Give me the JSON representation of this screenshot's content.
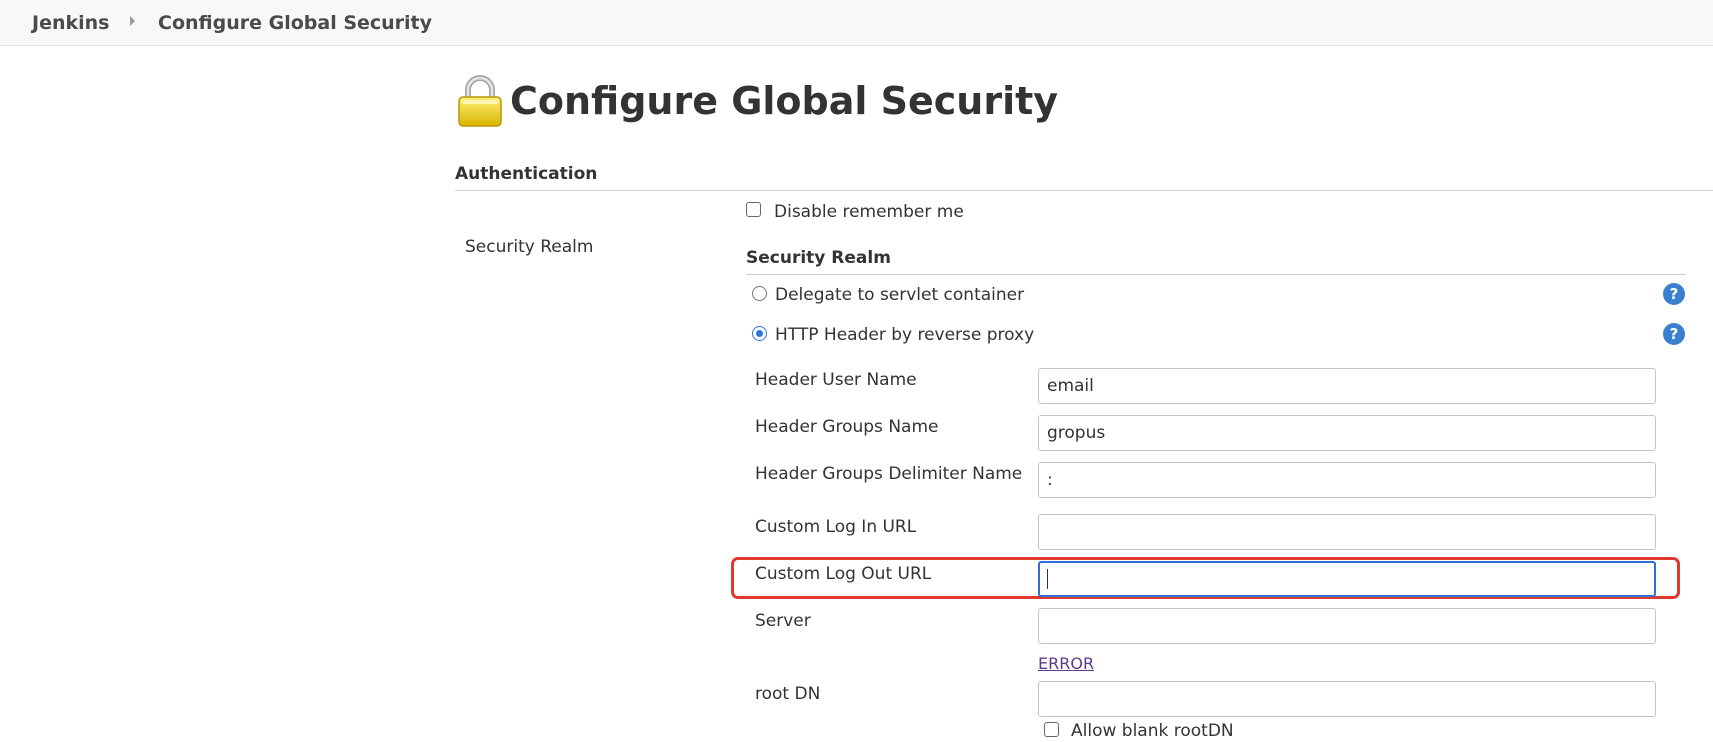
{
  "breadcrumb": {
    "home": "Jenkins",
    "current": "Configure Global Security"
  },
  "page": {
    "title": "Configure Global Security",
    "icon": "lock-icon"
  },
  "authentication": {
    "heading": "Authentication",
    "disable_remember_me": {
      "label": "Disable remember me",
      "checked": false
    }
  },
  "security_realm": {
    "left_label": "Security Realm",
    "heading": "Security Realm",
    "options": [
      {
        "label": "Delegate to servlet container",
        "selected": false
      },
      {
        "label": "HTTP Header by reverse proxy",
        "selected": true
      }
    ],
    "fields": {
      "header_user_name": {
        "label": "Header User Name",
        "value": "email"
      },
      "header_groups_name": {
        "label": "Header Groups Name",
        "value": "gropus"
      },
      "header_groups_delimiter": {
        "label": "Header Groups Delimiter Name",
        "value": ":"
      },
      "custom_login_url": {
        "label": "Custom Log In URL",
        "value": ""
      },
      "custom_logout_url": {
        "label": "Custom Log Out URL",
        "value": ""
      },
      "server": {
        "label": "Server",
        "value": ""
      },
      "root_dn": {
        "label": "root DN",
        "value": ""
      }
    },
    "server_error": "ERROR",
    "allow_blank_rootdn": {
      "label": "Allow blank rootDN",
      "checked": false
    }
  },
  "colors": {
    "accent": "#2f75e0",
    "highlight": "#e03a2f",
    "help_icon": "#3b7fd1",
    "error_link": "#5f3a8a"
  }
}
